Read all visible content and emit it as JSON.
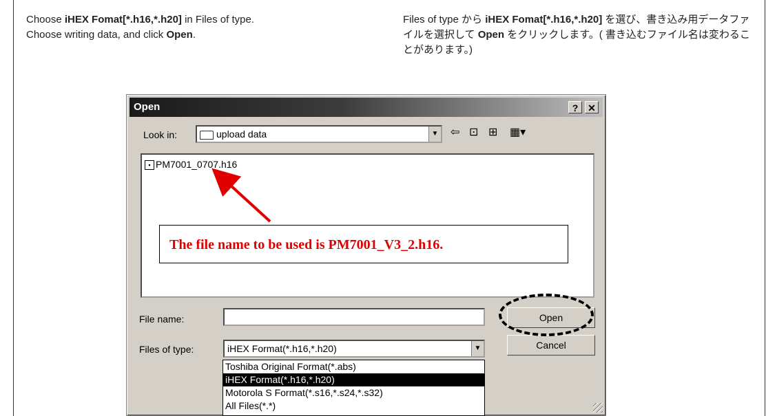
{
  "instructions": {
    "en_line1_pre": "Choose ",
    "en_line1_bold": "iHEX Fomat[*.h16,*.h20]",
    "en_line1_post": " in Files of type.",
    "en_line2_pre": "Choose writing data, and click ",
    "en_line2_bold": "Open",
    "en_line2_post": ".",
    "ja_pre": "Files of type から ",
    "ja_bold1": "iHEX Fomat[*.h16,*.h20]",
    "ja_mid": " を選び、書き込み用データファイルを選択して ",
    "ja_bold2": "Open",
    "ja_post": " をクリックします。( 書き込むファイル名は変わることがあります。)"
  },
  "dialog": {
    "title": "Open",
    "help_button": "?",
    "close_button": "✕",
    "look_in_label": "Look in:",
    "look_in_value": "upload data",
    "files": [
      {
        "name": "PM7001_0707.h16"
      }
    ],
    "file_name_label": "File name:",
    "file_name_value": "",
    "files_of_type_label": "Files of type:",
    "files_of_type_value": "iHEX Format(*.h16,*.h20)",
    "type_options": [
      "Toshiba Original Format(*.abs)",
      "iHEX Format(*.h16,*.h20)",
      "Motorola S Format(*.s16,*.s24,*.s32)",
      "All Files(*.*)"
    ],
    "selected_option_index": 1,
    "open_button": "Open",
    "cancel_button": "Cancel"
  },
  "annotation": {
    "text": "The file name to be used is PM7001_V3_2.h16.",
    "color": "#e00000"
  },
  "icons": [
    "folder-icon",
    "back-arrow-icon",
    "up-folder-icon",
    "new-folder-icon",
    "view-menu-icon",
    "file-icon",
    "dropdown-arrow-icon"
  ]
}
